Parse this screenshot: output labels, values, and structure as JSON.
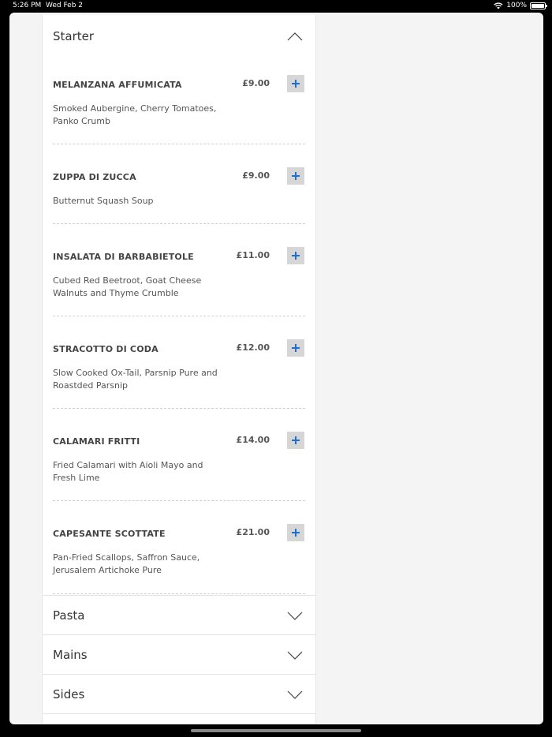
{
  "status_bar": {
    "time": "5:26 PM",
    "date": "Wed Feb 2",
    "battery": "100%"
  },
  "starter": {
    "title": "Starter",
    "items": [
      {
        "name": "MELANZANA AFFUMICATA",
        "price": "£9.00",
        "description": "Smoked Aubergine, Cherry Tomatoes, Panko Crumb"
      },
      {
        "name": "ZUPPA DI ZUCCA",
        "price": "£9.00",
        "description": "Butternut Squash Soup"
      },
      {
        "name": "INSALATA DI BARBABIETOLE",
        "price": "£11.00",
        "description": "Cubed Red Beetroot, Goat Cheese Walnuts and Thyme Crumble"
      },
      {
        "name": "STRACOTTO DI CODA",
        "price": "£12.00",
        "description": "Slow Cooked Ox-Tail, Parsnip Pure and Roastded Parsnip"
      },
      {
        "name": "CALAMARI FRITTI",
        "price": "£14.00",
        "description": "Fried Calamari with Aioli Mayo and Fresh Lime"
      },
      {
        "name": "CAPESANTE SCOTTATE",
        "price": "£21.00",
        "description": "Pan-Fried Scallops, Saffron Sauce, Jerusalem Artichoke Pure"
      }
    ]
  },
  "collapsed_sections": [
    {
      "title": "Pasta"
    },
    {
      "title": "Mains"
    },
    {
      "title": "Sides"
    }
  ],
  "colors": {
    "accent_plus": "#1f6fd1",
    "add_button_bg": "#d6d6d6"
  },
  "icons": {
    "expand": "chevron-up-icon",
    "collapse": "chevron-down-icon",
    "add": "plus-icon"
  }
}
